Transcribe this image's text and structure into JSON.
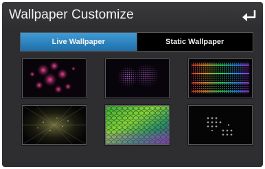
{
  "header": {
    "title": "Wallpaper Customize",
    "back_icon": "back-arrow-icon"
  },
  "tabs": [
    {
      "label": "Live Wallpaper",
      "active": true
    },
    {
      "label": "Static Wallpaper",
      "active": false
    }
  ],
  "wallpapers": [
    {
      "name": "pink-bokeh"
    },
    {
      "name": "purple-dots-circles"
    },
    {
      "name": "rainbow-grid-lines"
    },
    {
      "name": "dark-light-burst"
    },
    {
      "name": "green-hexagon-mosaic"
    },
    {
      "name": "gray-dot-pattern"
    }
  ],
  "colors": {
    "accent": "#2f86c4",
    "background": "#2e2e30",
    "text": "#f2f2f2"
  }
}
